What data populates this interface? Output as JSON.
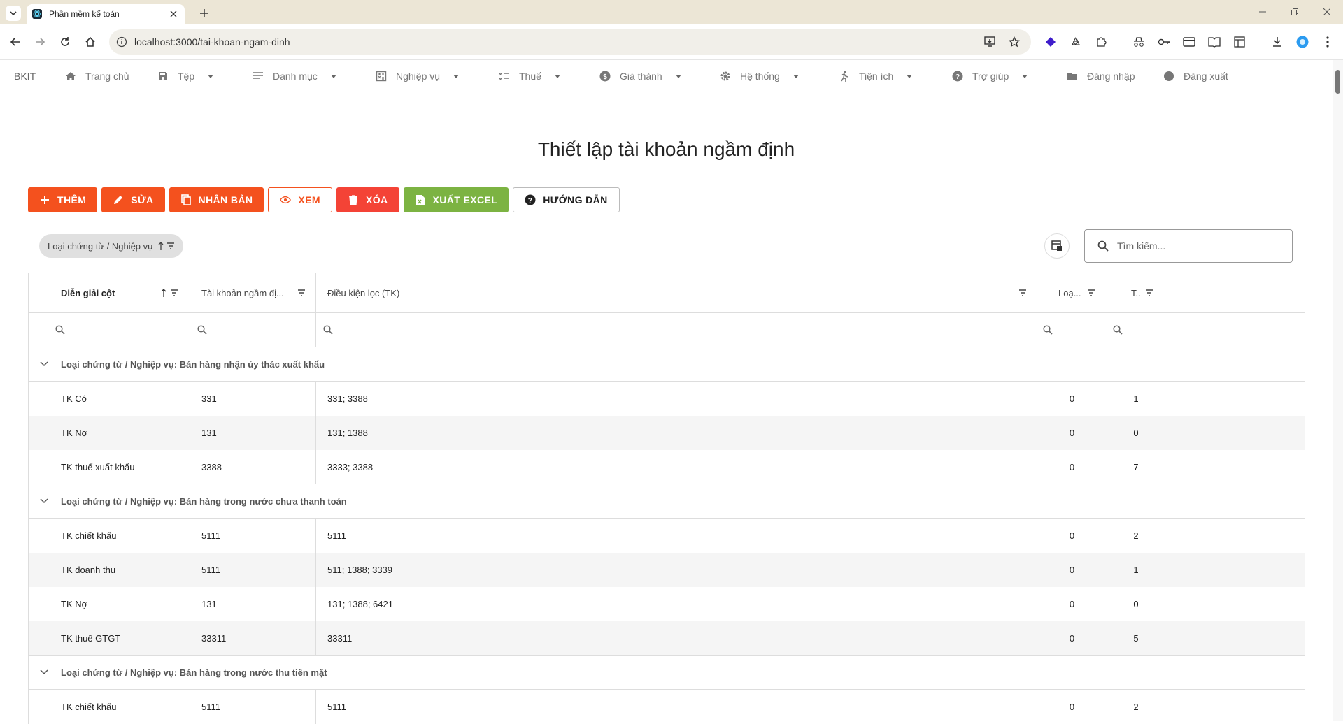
{
  "browser": {
    "tab_title": "Phần mềm kế toán",
    "url": "localhost:3000/tai-khoan-ngam-dinh"
  },
  "nav": {
    "brand": "BKIT",
    "items": [
      {
        "label": "Trang chủ",
        "icon": "home-icon",
        "dropdown": false
      },
      {
        "label": "Tệp",
        "icon": "save-icon",
        "dropdown": true
      },
      {
        "label": "Danh mục",
        "icon": "list-icon",
        "dropdown": true
      },
      {
        "label": "Nghiệp vụ",
        "icon": "calculator-icon",
        "dropdown": true
      },
      {
        "label": "Thuế",
        "icon": "checklist-icon",
        "dropdown": true
      },
      {
        "label": "Giá thành",
        "icon": "dollar-icon",
        "dropdown": true
      },
      {
        "label": "Hệ thống",
        "icon": "gear-icon",
        "dropdown": true
      },
      {
        "label": "Tiện ích",
        "icon": "run-icon",
        "dropdown": true
      },
      {
        "label": "Trợ giúp",
        "icon": "help-icon",
        "dropdown": true
      },
      {
        "label": "Đăng nhập",
        "icon": "folder-icon",
        "dropdown": false
      },
      {
        "label": "Đăng xuất",
        "icon": "circle-icon",
        "dropdown": false
      }
    ]
  },
  "page": {
    "title": "Thiết lập tài khoản ngầm định"
  },
  "toolbar": {
    "add": "THÊM",
    "edit": "SỬA",
    "duplicate": "NHÂN BẢN",
    "view": "XEM",
    "delete": "XÓA",
    "export": "XUẤT EXCEL",
    "guide": "HƯỚNG DẪN"
  },
  "grouping": {
    "chip_label": "Loại chứng từ / Nghiệp vụ"
  },
  "search": {
    "placeholder": "Tìm kiếm..."
  },
  "grid": {
    "columns": [
      "Diễn giải cột",
      "Tài khoản ngầm đị...",
      "Điều kiện lọc (TK)",
      "Loạ...",
      "T.."
    ],
    "group_prefix": "Loại chứng từ / Nghiệp vụ: ",
    "groups": [
      {
        "name": "Bán hàng nhận ủy thác xuất khẩu",
        "rows": [
          {
            "desc": "TK Có",
            "account": "331",
            "filter": "331; 3388",
            "type": "0",
            "t": "1"
          },
          {
            "desc": "TK Nợ",
            "account": "131",
            "filter": "131; 1388",
            "type": "0",
            "t": "0"
          },
          {
            "desc": "TK thuế xuất khẩu",
            "account": "3388",
            "filter": "3333; 3388",
            "type": "0",
            "t": "7"
          }
        ]
      },
      {
        "name": "Bán hàng trong nước chưa thanh toán",
        "rows": [
          {
            "desc": "TK chiết khấu",
            "account": "5111",
            "filter": "5111",
            "type": "0",
            "t": "2"
          },
          {
            "desc": "TK doanh thu",
            "account": "5111",
            "filter": "511; 1388; 3339",
            "type": "0",
            "t": "1"
          },
          {
            "desc": "TK Nợ",
            "account": "131",
            "filter": "131; 1388; 6421",
            "type": "0",
            "t": "0"
          },
          {
            "desc": "TK thuế GTGT",
            "account": "33311",
            "filter": "33311",
            "type": "0",
            "t": "5"
          }
        ]
      },
      {
        "name": "Bán hàng trong nước thu tiền mặt",
        "rows": [
          {
            "desc": "TK chiết khấu",
            "account": "5111",
            "filter": "5111",
            "type": "0",
            "t": "2"
          }
        ]
      }
    ]
  }
}
